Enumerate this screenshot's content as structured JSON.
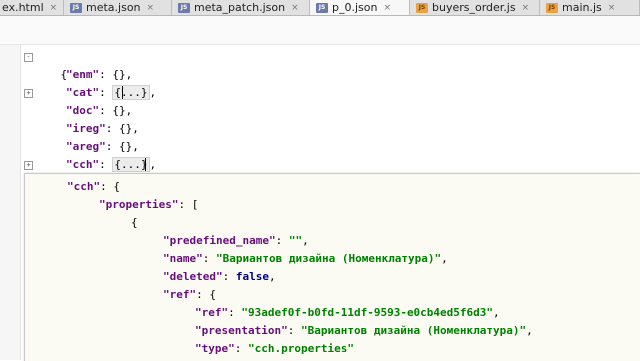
{
  "tabs": [
    {
      "label": "ex.html",
      "icon": "html-file-icon",
      "active": false
    },
    {
      "label": "meta.json",
      "icon": "json-file-icon",
      "active": false
    },
    {
      "label": "meta_patch.json",
      "icon": "json-file-icon",
      "active": false
    },
    {
      "label": "p_0.json",
      "icon": "json-file-icon",
      "active": true
    },
    {
      "label": "buyers_order.js",
      "icon": "js-file-icon",
      "active": false
    },
    {
      "label": "main.js",
      "icon": "js-file-icon",
      "active": false
    }
  ],
  "tab_close_glyph": "×",
  "code": {
    "open_brace": "{",
    "enm_key": "\"enm\"",
    "enm_val": "{},",
    "cat_key": "\"cat\"",
    "cat_val": "{...}",
    "cat_tail": ",",
    "doc_key": "\"doc\"",
    "doc_val": "{},",
    "ireg_key": "\"ireg\"",
    "ireg_val": "{},",
    "areg_key": "\"areg\"",
    "areg_val": "{},",
    "cch_key": "\"cch\"",
    "cch_val": "{...}",
    "cch_tail": ","
  },
  "popup": {
    "cch_key": "\"cch\"",
    "cch_open": "{",
    "properties_key": "\"properties\"",
    "properties_open": "[",
    "obj_open": "{",
    "predefined_name_key": "\"predefined_name\"",
    "predefined_name_val": "\"\"",
    "name_key": "\"name\"",
    "name_val": "\"Вариантов дизайна (Номенклатура)\"",
    "deleted_key": "\"deleted\"",
    "deleted_val": "false",
    "ref_key": "\"ref\"",
    "ref_open": "{",
    "ref_ref_key": "\"ref\"",
    "ref_ref_val": "\"93adef0f-b0fd-11df-9593-e0cb4ed5f6d3\"",
    "presentation_key": "\"presentation\"",
    "presentation_val": "\"Вариантов дизайна (Номенклатура)\"",
    "type_key": "\"type\"",
    "type_val": "\"cch.properties\""
  }
}
